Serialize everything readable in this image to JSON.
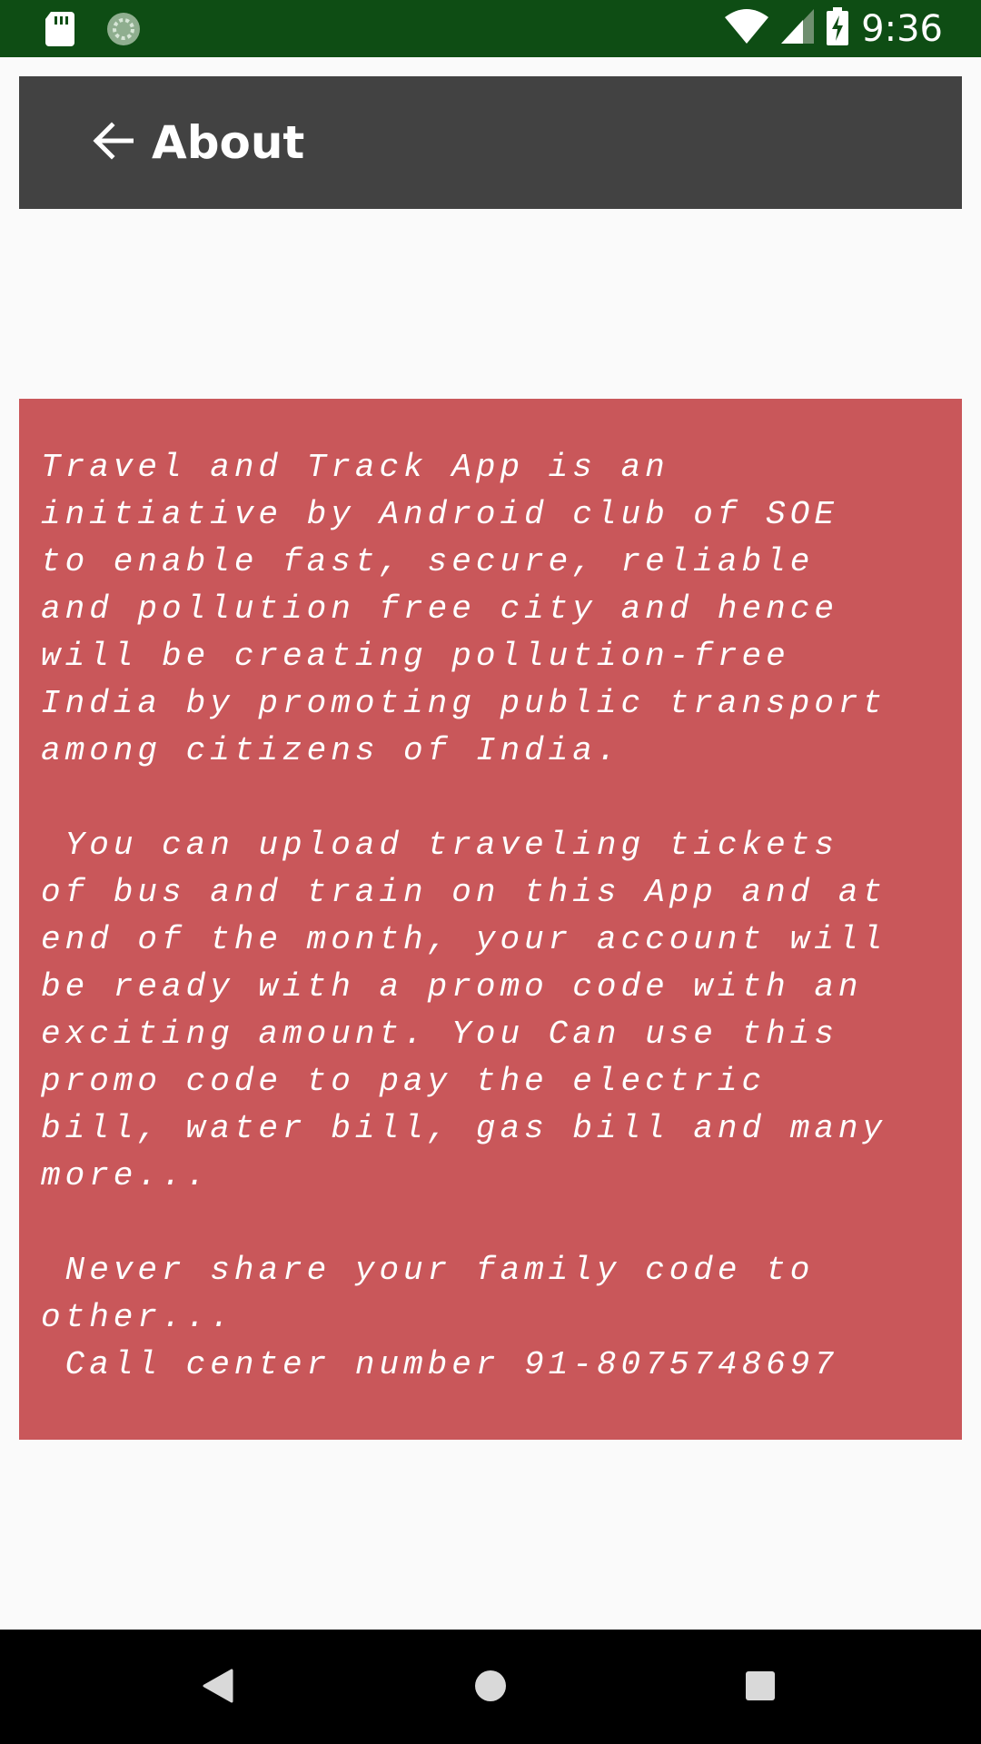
{
  "status_bar": {
    "time": "9:36",
    "icons": [
      "sd-card-icon",
      "sync-icon",
      "wifi-icon",
      "signal-icon",
      "battery-charging-icon"
    ]
  },
  "toolbar": {
    "title": "About",
    "back_icon": "arrow-back-icon",
    "background": "#424242"
  },
  "content": {
    "about_text": "Travel and Track App is an\ninitiative by Android club of SOE\nto enable fast, secure, reliable\nand pollution free city and hence\nwill be creating pollution-free\nIndia by promoting public transport\namong citizens of India.\n\n You can upload traveling tickets\nof bus and train on this App and at\nend of the month, your account will\nbe ready with a promo code with an\nexciting amount. You Can use this\npromo code to pay the electric\nbill, water bill, gas bill and many\nmore...\n\n Never share your family code to\nother...\n Call center number 91-8075748697",
    "card_color": "#c9575a"
  },
  "nav_bar": {
    "buttons": [
      "back-triangle-icon",
      "home-circle-icon",
      "recents-square-icon"
    ]
  },
  "colors": {
    "status_bar": "#0e4d14",
    "page_background": "#fafafa"
  }
}
